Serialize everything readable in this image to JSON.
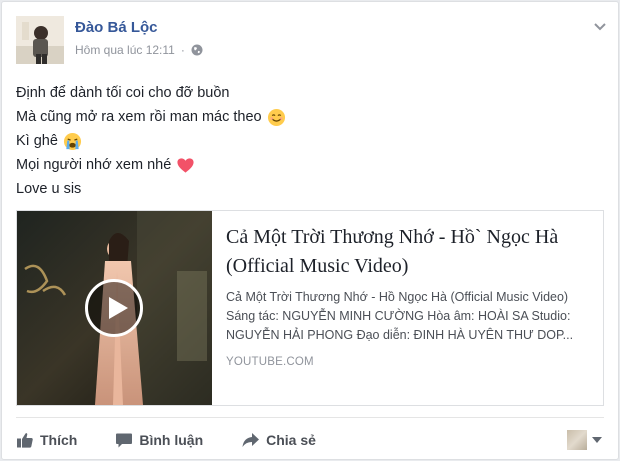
{
  "post": {
    "author": "Đào Bá Lộc",
    "timestamp": "Hôm qua lúc 12:11",
    "privacy_icon": "globe-icon",
    "menu_icon": "chevron-down-icon",
    "lines": [
      {
        "text": "Định để dành tối coi cho đỡ buồn",
        "emoji": null
      },
      {
        "text": "Mà cũng mở ra xem rồi man mác theo",
        "emoji": "smiling-face-icon"
      },
      {
        "text": "Kì ghê",
        "emoji": "crying-face-icon"
      },
      {
        "text": "Mọi người nhớ xem nhé",
        "emoji": "heart-icon"
      },
      {
        "text": "Love u sis",
        "emoji": null
      }
    ]
  },
  "link_card": {
    "title": "Cả Một Trời Thương Nhớ - Hồ` Ngọc Hà (Official Music Video)",
    "description": "Cả Một Trời Thương Nhớ - Hồ Ngọc Hà (Official Music Video) Sáng tác: NGUYỄN MINH CƯỜNG Hòa âm: HOÀI SA Studio: NGUYỄN HẢI PHONG Đạo diễn: ĐINH HÀ UYÊN THƯ DOP...",
    "domain": "YOUTUBE.COM",
    "thumb_icon": "play-icon"
  },
  "actions": {
    "like": "Thích",
    "comment": "Bình luận",
    "share": "Chia sẻ"
  },
  "colors": {
    "author": "#365899",
    "meta": "#90949c",
    "action": "#4b4f56",
    "heart": "#f25268",
    "emoji_yellow": "#ffcc4d"
  }
}
